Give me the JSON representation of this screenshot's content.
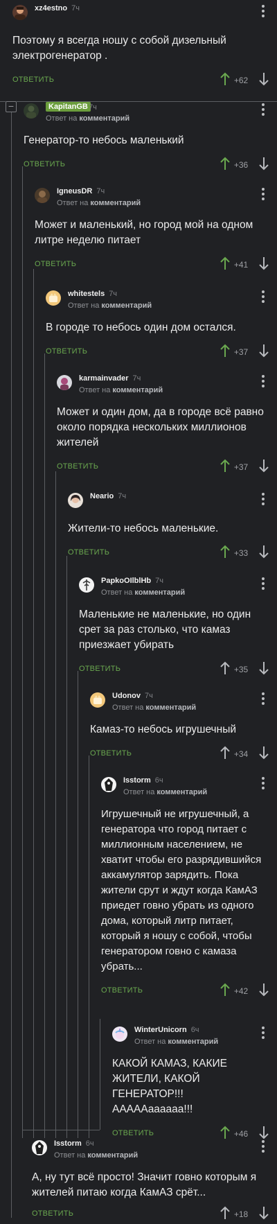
{
  "ui": {
    "reply_label": "ОТВЕТИТЬ",
    "reply_to_prefix": "Ответ на",
    "reply_to_target": "комментарий",
    "collapse_glyph": "−",
    "accent_green": "#6aa84f",
    "badge_green": "#6b9d3c"
  },
  "comments": [
    {
      "author": "xz4estno",
      "time": "7ч",
      "text": "Поэтому я всегда ношу с собой дизельный электрогенератор .",
      "score": "+62",
      "avatar": "user-avatar-icon"
    },
    {
      "author": "KapitanGB",
      "time": "7ч",
      "text": "Генератор-то небось маленький",
      "score": "+36",
      "avatar": "user-avatar-icon"
    },
    {
      "author": "IgneusDR",
      "time": "7ч",
      "text": "Может и маленький, но город мой на одном литре неделю питает",
      "score": "+41",
      "avatar": "user-avatar-icon"
    },
    {
      "author": "whitestels",
      "time": "7ч",
      "text": "В городе то небось один дом остался.",
      "score": "+37",
      "avatar": "user-avatar-icon"
    },
    {
      "author": "karmainvader",
      "time": "7ч",
      "text": "Может и один дом, да в городе всё равно около порядка нескольких миллионов жителей",
      "score": "+37",
      "avatar": "user-avatar-icon"
    },
    {
      "author": "Neario",
      "time": "7ч",
      "text": "Жители-то небось маленькие.",
      "score": "+33",
      "avatar": "user-avatar-icon"
    },
    {
      "author": "PapkoOIlblHb",
      "time": "7ч",
      "text": "Маленькие не маленькие, но один срет за раз столько, что камаз приезжает убирать",
      "score": "+35",
      "avatar": "user-avatar-icon"
    },
    {
      "author": "Udonov",
      "time": "7ч",
      "text": "Камаз-то небось игрушечный",
      "score": "+34",
      "avatar": "user-avatar-icon"
    },
    {
      "author": "Isstorm",
      "time": "6ч",
      "text": "Игрушечный не игрушечный, а генератора что город питает с миллионным населением, не хватит чтобы его разрядившийся аккамулятор зарядить. Пока жители срут и ждут когда КамАЗ приедет говно убрать из одного дома, который литр питает, который я ношу с собой, чтобы генератором говно с камаза убрать...",
      "score": "+42",
      "avatar": "user-avatar-icon"
    },
    {
      "author": "WinterUnicorn",
      "time": "6ч",
      "text": "КАКОЙ КАМАЗ, КАКИЕ ЖИТЕЛИ, КАКОЙ ГЕНЕРАТОР!!! AAAAAaaaaaa!!!",
      "score": "+46",
      "avatar": "user-avatar-icon"
    },
    {
      "author": "Isstorm",
      "time": "6ч",
      "text": "А, ну тут всё просто! Значит говно которым я жителей питаю когда КамАЗ срёт...",
      "score": "+18",
      "avatar": "user-avatar-icon"
    }
  ]
}
